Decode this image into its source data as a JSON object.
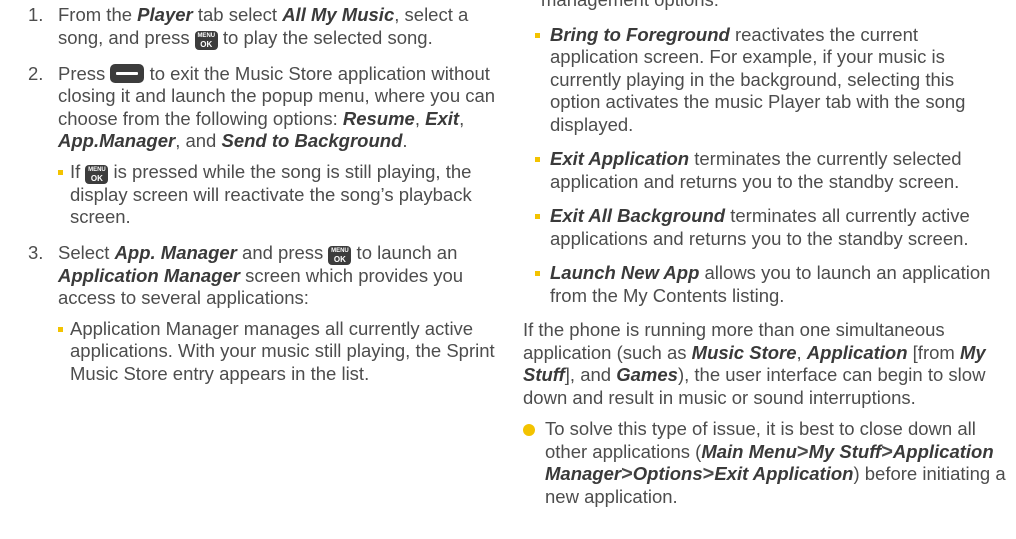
{
  "left": {
    "step1": {
      "num": "1.",
      "t1": "From the ",
      "e1": "Player",
      "t2": " tab select ",
      "e2": "All My Music",
      "t3": ", select a song, and press ",
      "t4": " to play the selected song."
    },
    "step2": {
      "num": "2.",
      "t1": "Press ",
      "t2": " to exit the Music Store application without closing it and launch the popup menu, where you can choose from the following options: ",
      "e1": "Resume",
      "c1": ", ",
      "e2": "Exit",
      "c2": ", ",
      "e3": "App.Manager",
      "c3": ", and ",
      "e4": "Send to Background",
      "c4": "."
    },
    "step2_sub": {
      "t1": "If ",
      "t2": " is pressed while the song is still playing, the display screen will reactivate the song’s playback screen."
    },
    "step3": {
      "num": "3.",
      "t1": "Select ",
      "e1": "App. Manager",
      "t2": " and press ",
      "t3": " to launch an ",
      "e2": "Application Manager",
      "t4": " screen which provides you access to several applications:"
    },
    "step3_sub": "Application Manager manages all currently active applications. With your music still playing, the Sprint Music Store entry appears in the list."
  },
  "right": {
    "top_fragment": "management options:",
    "items": [
      {
        "term": "Bring to Foreground",
        "desc": " reactivates the current application screen. For example, if your music is currently playing in the background, selecting this option activates the music Player tab with the song displayed."
      },
      {
        "term": "Exit Application",
        "desc": " terminates the currently selected application and returns you to the standby screen."
      },
      {
        "term": "Exit All Background",
        "desc": " terminates all currently active applications and returns you to the standby screen."
      },
      {
        "term": "Launch New App",
        "desc": " allows you to launch an application from the My Contents listing."
      }
    ],
    "para": {
      "t1": "If the phone is running more than one simultaneous application (such as ",
      "e1": "Music Store",
      "t2": ", ",
      "e2": "Application",
      "t3": " [from ",
      "e3": "My Stuff",
      "t4": "], and ",
      "e4": "Games",
      "t5": "), the user interface can begin to slow down and result in music or sound interruptions."
    },
    "tip": {
      "t1": "To solve this type of issue, it is best to close down all other applications (",
      "p1": "Main Menu",
      "p2": "My Stuff",
      "p3": "Application Manager",
      "p4": "Options",
      "p5": "Exit Application",
      "gt": ">",
      "t2": ") before initiating a new application."
    }
  },
  "keys": {
    "menu_top": "MENU",
    "menu_bottom": "OK"
  },
  "colors": {
    "bullet": "#f3c300",
    "text": "#4d4d4d",
    "key": "#3c3c3c"
  }
}
